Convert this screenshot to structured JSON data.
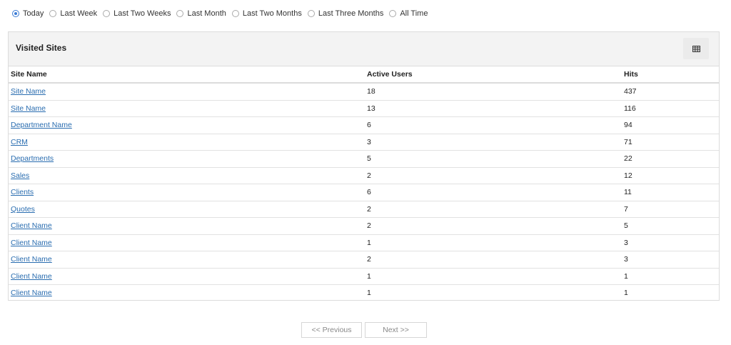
{
  "filters": {
    "options": [
      "Today",
      "Last Week",
      "Last Two Weeks",
      "Last Month",
      "Last Two Months",
      "Last Three Months",
      "All Time"
    ],
    "selected": "Today"
  },
  "panel": {
    "title": "Visited Sites",
    "view_icon": "table-icon"
  },
  "table": {
    "headers": {
      "site": "Site Name",
      "users": "Active Users",
      "hits": "Hits"
    },
    "rows": [
      {
        "site": "Site Name",
        "users": "18",
        "hits": "437"
      },
      {
        "site": "Site Name",
        "users": "13",
        "hits": "116"
      },
      {
        "site": "Department Name",
        "users": "6",
        "hits": "94"
      },
      {
        "site": "CRM",
        "users": "3",
        "hits": "71"
      },
      {
        "site": "Departments",
        "users": "5",
        "hits": "22"
      },
      {
        "site": "Sales",
        "users": "2",
        "hits": "12"
      },
      {
        "site": "Clients",
        "users": "6",
        "hits": "11"
      },
      {
        "site": "Quotes",
        "users": "2",
        "hits": "7"
      },
      {
        "site": "Client Name",
        "users": "2",
        "hits": "5"
      },
      {
        "site": "Client Name",
        "users": "1",
        "hits": "3"
      },
      {
        "site": "Client Name",
        "users": "2",
        "hits": "3"
      },
      {
        "site": "Client Name",
        "users": "1",
        "hits": "1"
      },
      {
        "site": "Client Name",
        "users": "1",
        "hits": "1"
      }
    ]
  },
  "pager": {
    "previous": "<< Previous",
    "next": "Next >>"
  },
  "colors": {
    "link": "#2a6db0",
    "radio_selected": "#3a7bd5",
    "header_bg": "#f3f3f3",
    "border": "#dcdcdc"
  }
}
